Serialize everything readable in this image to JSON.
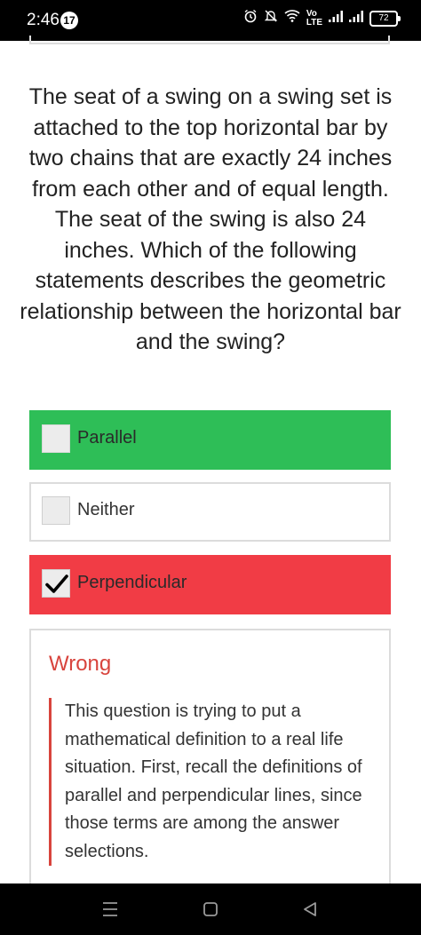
{
  "status_bar": {
    "time": "2:46",
    "notification_count": "17",
    "network_label": "Vo\nLTE",
    "battery": "72",
    "icons": [
      "alarm-icon",
      "mute-icon",
      "wifi-icon",
      "signal-icon",
      "signal-icon",
      "battery-icon"
    ]
  },
  "question": {
    "text": "The seat of a swing on a swing set is attached to the top horizontal bar by two chains that are exactly 24 inches from each other and of equal length. The seat of the swing is also 24 inches. Which of the following statements describes the geometric relationship between the horizontal bar and the swing?"
  },
  "options": [
    {
      "label": "Parallel",
      "state": "correct",
      "checked": false,
      "color": "#2ebe57"
    },
    {
      "label": "Neither",
      "state": "neutral",
      "checked": false,
      "color": "#ffffff"
    },
    {
      "label": "Perpendicular",
      "state": "wrong",
      "checked": true,
      "color": "#f13c45"
    }
  ],
  "feedback": {
    "title": "Wrong",
    "title_color": "#d8443d",
    "explanation": "This question is trying to put a mathematical definition to a real life situation. First, recall the definitions of parallel and perpendicular lines, since those terms are among the answer selections."
  },
  "nav_bar": {
    "buttons": [
      "recent-apps-icon",
      "home-icon",
      "back-icon"
    ]
  }
}
